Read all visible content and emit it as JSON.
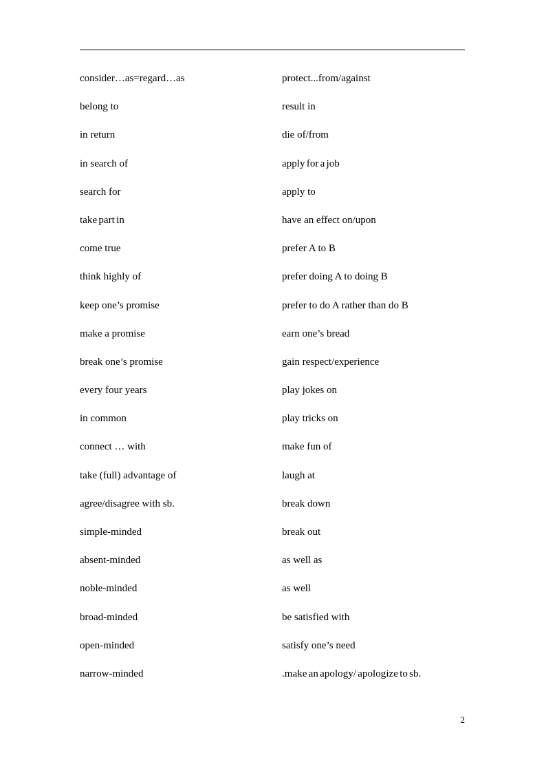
{
  "document": {
    "page_number": "2",
    "header_rule": true,
    "text_color": "#000000",
    "background_color": "#ffffff"
  },
  "columns": {
    "left": [
      "consider…as=regard…as",
      "belong to",
      "in return",
      "in search of",
      "search for",
      "take part in",
      "come true",
      "think highly of",
      "keep one’s promise",
      "make a promise",
      "break one’s promise",
      "every four years",
      "in common",
      "connect … with",
      "take (full) advantage of",
      "agree/disagree with sb.",
      "simple-minded",
      "absent-minded",
      "noble-minded",
      "broad-minded",
      "open-minded",
      "narrow-minded"
    ],
    "right": [
      "protect...from/against",
      "result in",
      "die of/from",
      "apply for a job",
      "apply to",
      "have an effect on/upon",
      "prefer A to B",
      "prefer doing A to doing B",
      "prefer to do A rather than do B",
      "earn one’s bread",
      "gain respect/experience",
      "play jokes on",
      "play tricks on",
      "make fun of",
      "laugh at",
      "break down",
      "break out",
      "as well as",
      "as well",
      "be satisfied with",
      "satisfy one’s need",
      ".make an apology/ apologize to sb."
    ]
  },
  "tight_rows": {
    "left": [
      5
    ],
    "right": [
      3,
      21
    ]
  }
}
